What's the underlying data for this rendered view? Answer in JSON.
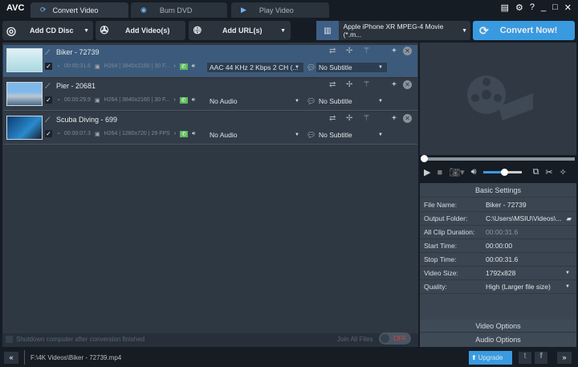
{
  "app": {
    "logo": "AVC"
  },
  "tabs": [
    {
      "label": "Convert Video",
      "active": true
    },
    {
      "label": "Burn DVD"
    },
    {
      "label": "Play Video"
    }
  ],
  "toolbar": {
    "add_cd": "Add CD Disc",
    "add_video": "Add Video(s)",
    "add_url": "Add URL(s)",
    "profile": "Apple iPhone XR MPEG-4 Movie (*.m...",
    "convert": "Convert Now!"
  },
  "files": [
    {
      "name": "Biker - 72739",
      "duration": "00:00:31.6",
      "info": "H264 | 3840x2160 | 30 F...",
      "audio": "AAC 44 KHz 2 Kbps 2 CH (...",
      "subtitle": "No Subtitle",
      "selected": true
    },
    {
      "name": "Pier - 20681",
      "duration": "00:00:29.9",
      "info": "H264 | 3840x2160 | 30 F...",
      "audio": "No Audio",
      "subtitle": "No Subtitle"
    },
    {
      "name": "Scuba Diving - 699",
      "duration": "00:00:07.3",
      "info": "H264 | 1280x720 | 29 FPS",
      "audio": "No Audio",
      "subtitle": "No Subtitle"
    }
  ],
  "player": {
    "progress": 0,
    "volume": 0.55
  },
  "settings": {
    "title": "Basic Settings",
    "rows": [
      {
        "label": "File Name:",
        "value": "Biker - 72739"
      },
      {
        "label": "Output Folder:",
        "value": "C:\\Users\\MSIU\\Videos\\..."
      },
      {
        "label": "All Clip Duration:",
        "value": "00:00:31.6"
      },
      {
        "label": "Start Time:",
        "value": "00:00:00"
      },
      {
        "label": "Stop Time:",
        "value": "00:00:31.6"
      },
      {
        "label": "Video Size:",
        "value": "1792x828"
      },
      {
        "label": "Quality:",
        "value": "High (Larger file size)"
      }
    ],
    "video_options": "Video Options",
    "audio_options": "Audio Options"
  },
  "footer": {
    "shutdown": "Shutdown computer after conversion finished",
    "join": "Join All Files",
    "toggle": "OFF",
    "path": "F:\\4K Videos\\Biker - 72739.mp4",
    "upgrade": "Upgrade"
  },
  "colors": {
    "accent": "#3a9ae0",
    "selected_row": "#3c5b7c",
    "toggle_off": "#e04040"
  }
}
